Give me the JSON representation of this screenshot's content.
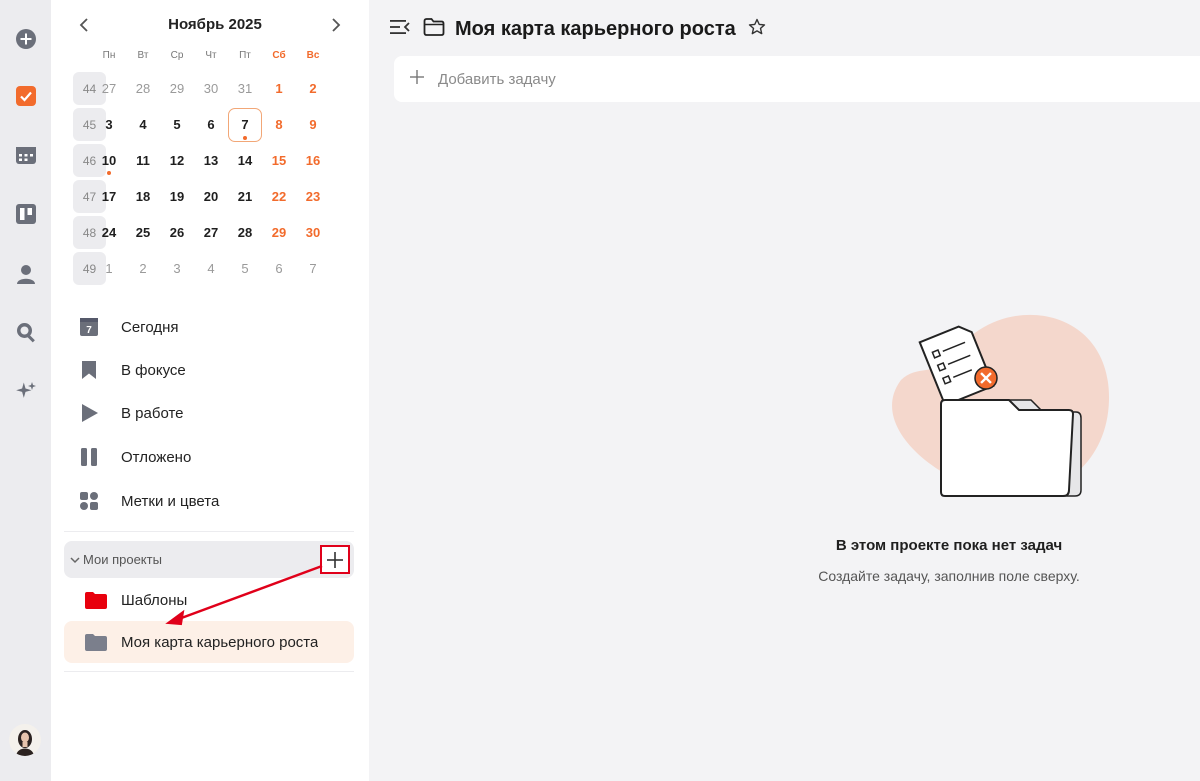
{
  "calendar": {
    "title": "Ноябрь 2025",
    "weekdays": [
      "Пн",
      "Вт",
      "Ср",
      "Чт",
      "Пт",
      "Сб",
      "Вс"
    ],
    "weeks": [
      {
        "num": "44",
        "days": [
          "27",
          "28",
          "29",
          "30",
          "31",
          "1",
          "2"
        ]
      },
      {
        "num": "45",
        "days": [
          "3",
          "4",
          "5",
          "6",
          "7",
          "8",
          "9"
        ]
      },
      {
        "num": "46",
        "days": [
          "10",
          "11",
          "12",
          "13",
          "14",
          "15",
          "16"
        ]
      },
      {
        "num": "47",
        "days": [
          "17",
          "18",
          "19",
          "20",
          "21",
          "22",
          "23"
        ]
      },
      {
        "num": "48",
        "days": [
          "24",
          "25",
          "26",
          "27",
          "28",
          "29",
          "30"
        ]
      },
      {
        "num": "49",
        "days": [
          "1",
          "2",
          "3",
          "4",
          "5",
          "6",
          "7"
        ]
      }
    ]
  },
  "nav": {
    "today": "Сегодня",
    "today_icon_num": "7",
    "focus": "В фокусе",
    "in_progress": "В работе",
    "postponed": "Отложено",
    "tags": "Метки и цвета"
  },
  "projects": {
    "header": "Мои проекты",
    "items": [
      {
        "label": "Шаблоны",
        "color": "#e8000d"
      },
      {
        "label": "Моя карта карьерного роста",
        "color": "#7b7f8c"
      }
    ]
  },
  "main": {
    "title": "Моя карта карьерного роста",
    "add_task_placeholder": "Добавить задачу",
    "empty_title": "В этом проекте пока нет задач",
    "empty_subtitle": "Создайте задачу, заполнив поле сверху."
  },
  "colors": {
    "accent": "#f26b2c",
    "highlight_box": "#e0001a"
  }
}
